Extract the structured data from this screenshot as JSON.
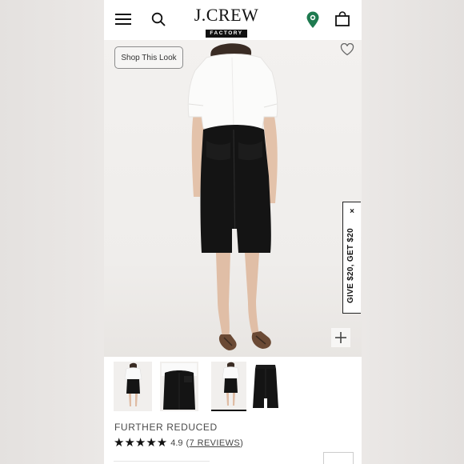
{
  "brand": {
    "name": "J.CREW",
    "sub": "FACTORY"
  },
  "colors": {
    "accent": "#1e7a4f",
    "text": "#111111"
  },
  "header": {
    "icons": [
      "menu-icon",
      "search-icon",
      "location-pin-icon",
      "shopping-bag-icon"
    ]
  },
  "hero": {
    "shop_look_label": "Shop This Look",
    "promo_label": "GIVE $20, GET $20",
    "promo_close": "×",
    "zoom_label": "+"
  },
  "thumbnails": {
    "count": 4,
    "active_index": 2
  },
  "product": {
    "status": "FURTHER REDUCED",
    "stars": "★★★★★",
    "rating": "4.9",
    "reviews_label": "7 REVIEWS",
    "rating_value": 4.9,
    "rating_max": 5
  }
}
